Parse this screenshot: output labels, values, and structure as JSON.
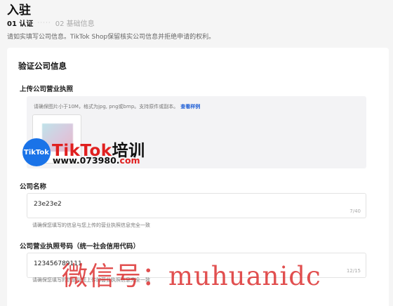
{
  "header": {
    "title": "入驻",
    "steps": [
      {
        "label": "01 认证",
        "active": true
      },
      {
        "label": "02 基础信息",
        "active": false
      }
    ],
    "step_separator": "·····",
    "notice": "请如实填写公司信息。TikTok Shop保留核实公司信息并拒绝申请的权利。"
  },
  "card": {
    "title": "验证公司信息",
    "license_upload": {
      "label": "上传公司营业执照",
      "hint": "请确保图片小于10M，格式为jpg, png或bmp。支持原件或副本。",
      "sample_link": "查看样例"
    },
    "company_name": {
      "label": "公司名称",
      "value": "23e23e2",
      "count": "7/40",
      "hint": "请确保您填写的信息与您上传的营业执照信息完全一致"
    },
    "license_number": {
      "label": "公司营业执照号码（统一社会信用代码）",
      "value": "123456789111",
      "count": "12/15",
      "hint": "请确保您填写的信息与您上传的营业执照信息完全一致"
    }
  },
  "watermark": {
    "logo_text": "TikTok",
    "title_red": "TikTok",
    "title_black": "培训",
    "url_black": "www.073980.",
    "url_red": "com",
    "wechat": "微信号：muhuanidc"
  },
  "colors": {
    "link": "#1f5fd6",
    "watermark_red": "#e02020",
    "logo_blue": "#1a73e8",
    "background": "#f5f5f5"
  }
}
